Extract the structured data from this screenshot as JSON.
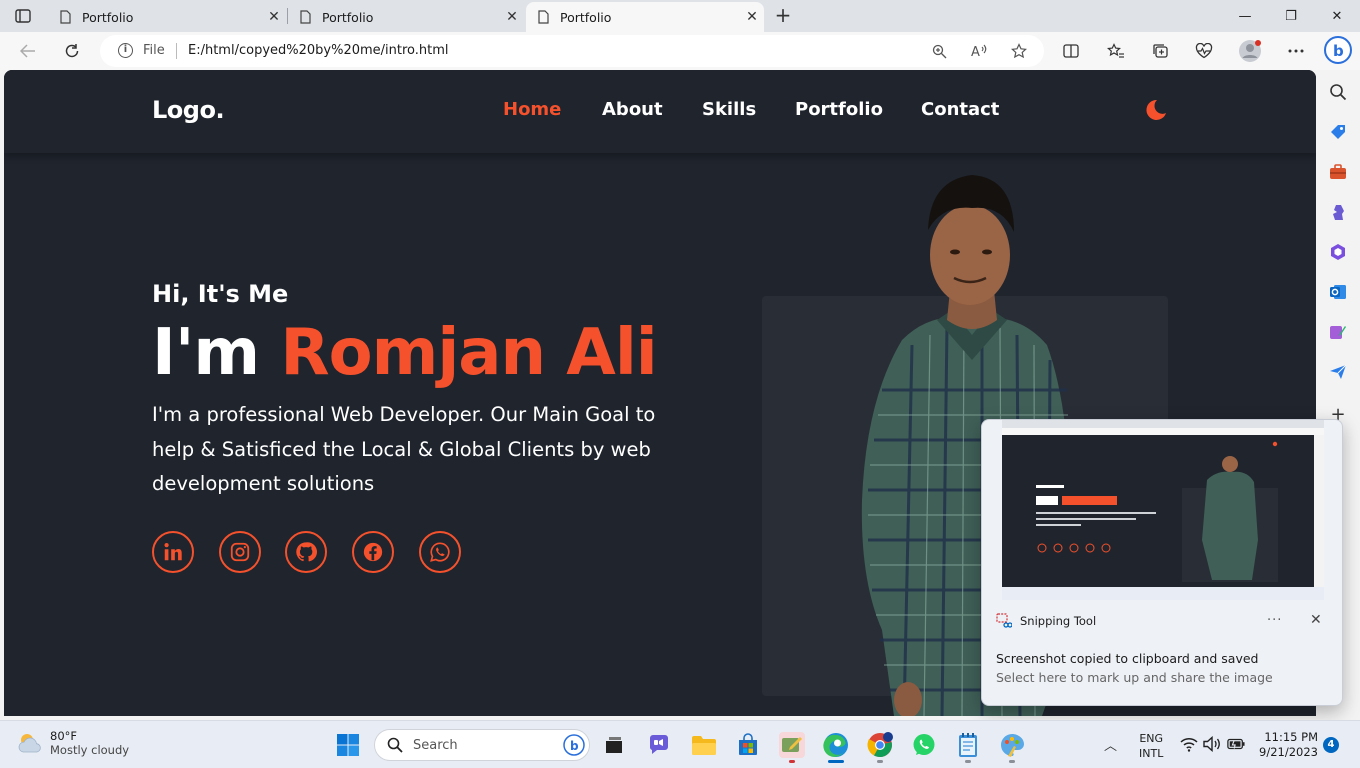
{
  "browser": {
    "tabs": [
      {
        "title": "Portfolio",
        "close": "✕",
        "active": false
      },
      {
        "title": "Portfolio",
        "close": "✕",
        "active": false
      },
      {
        "title": "Portfolio",
        "close": "✕",
        "active": true
      }
    ],
    "new_tab": "+",
    "window_controls": {
      "minimize": "—",
      "restore": "❐",
      "close": "✕"
    },
    "address": {
      "scheme_label": "File",
      "url": "E:/html/copyed%20by%20me/intro.html"
    }
  },
  "site": {
    "logo": "Logo.",
    "nav": [
      {
        "label": "Home",
        "active": true
      },
      {
        "label": "About",
        "active": false
      },
      {
        "label": "Skills",
        "active": false
      },
      {
        "label": "Portfolio",
        "active": false
      },
      {
        "label": "Contact",
        "active": false
      }
    ],
    "hero": {
      "greeting": "Hi, It's Me",
      "name_prefix": "I'm ",
      "name_accent": "Romjan Ali",
      "description": "I'm a professional Web Developer. Our Main Goal to help & Satisficed the Local & Global Clients by web development solutions"
    },
    "socials": [
      "linkedin-icon",
      "instagram-icon",
      "github-icon",
      "facebook-icon",
      "whatsapp-icon"
    ],
    "colors": {
      "accent": "#f4512c",
      "background": "#1f242d",
      "card": "#292d36",
      "text": "#ffffff"
    }
  },
  "toast": {
    "app_name": "Snipping Tool",
    "more": "···",
    "close": "✕",
    "title": "Screenshot copied to clipboard and saved",
    "subtitle": "Select here to mark up and share the image"
  },
  "taskbar": {
    "weather": {
      "temp": "80°F",
      "desc": "Mostly cloudy"
    },
    "search_placeholder": "Search",
    "tray_chevron": "︿",
    "lang": {
      "line1": "ENG",
      "line2": "INTL"
    },
    "clock": {
      "time": "11:15 PM",
      "date": "9/21/2023"
    },
    "notifications": "4"
  }
}
